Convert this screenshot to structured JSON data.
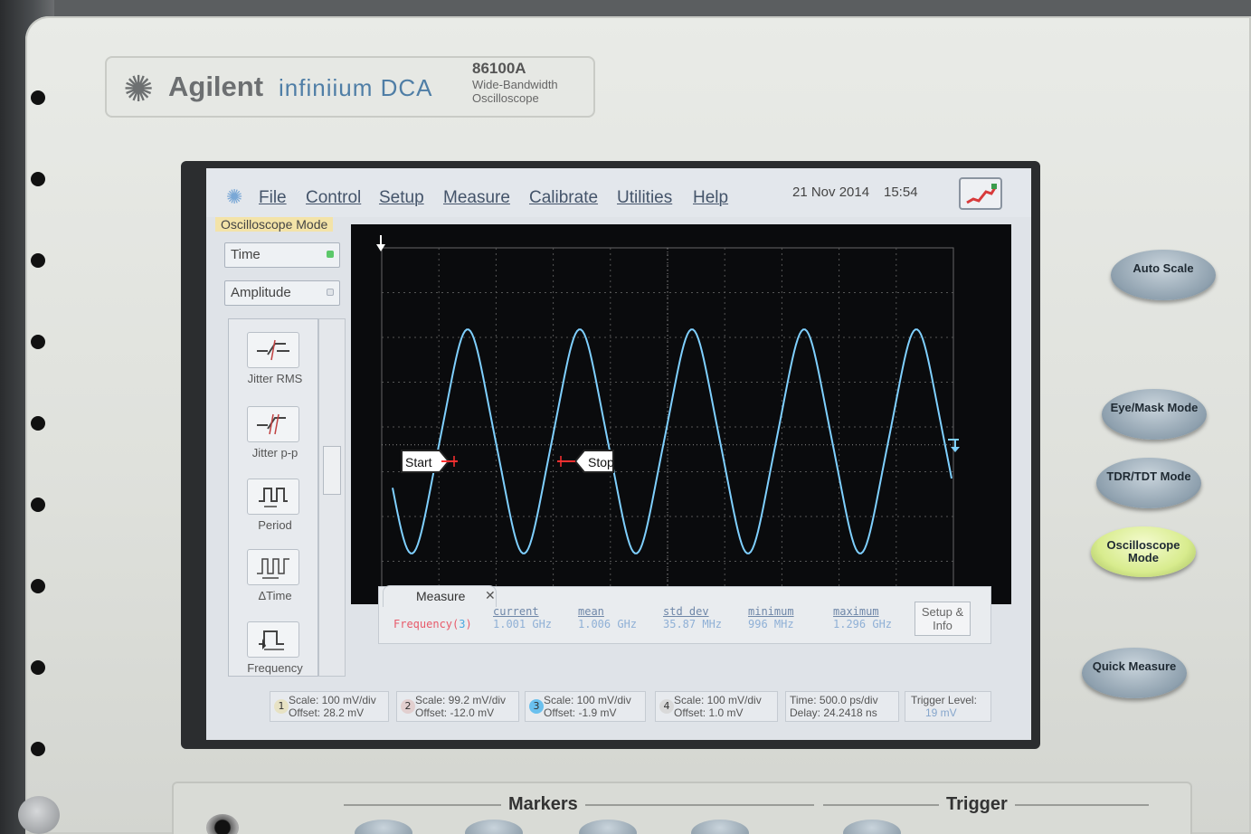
{
  "brand": {
    "name": "Agilent",
    "product": "infiniium DCA",
    "model": "86100A",
    "description": "Wide-Bandwidth Oscilloscope"
  },
  "menubar": {
    "items": [
      "File",
      "Control",
      "Setup",
      "Measure",
      "Calibrate",
      "Utilities",
      "Help"
    ],
    "date": "21 Nov 2014",
    "time": "15:54"
  },
  "mode_label": "Oscilloscope Mode",
  "side": {
    "time_button": "Time",
    "amplitude_button": "Amplitude",
    "tools": [
      "Jitter RMS",
      "Jitter p-p",
      "Period",
      "ΔTime",
      "Frequency"
    ]
  },
  "plot": {
    "start_marker": "Start",
    "stop_marker": "Stop",
    "trace_color": "#7fd0ff"
  },
  "measure": {
    "tab_label": "Measure",
    "headers": [
      "current",
      "mean",
      "std dev",
      "minimum",
      "maximum"
    ],
    "name": "Frequency(",
    "channel": "3",
    "name_close": ")",
    "values": [
      "1.001 GHz",
      "1.006 GHz",
      "35.87 MHz",
      "996 MHz",
      "1.296 GHz"
    ],
    "setup_label": "Setup & Info"
  },
  "channels": [
    {
      "num": "1",
      "scale": "Scale: 100 mV/div",
      "offset": "Offset: 28.2 mV"
    },
    {
      "num": "2",
      "scale": "Scale: 99.2 mV/div",
      "offset": "Offset: -12.0 mV"
    },
    {
      "num": "3",
      "scale": "Scale: 100 mV/div",
      "offset": "Offset: -1.9 mV"
    },
    {
      "num": "4",
      "scale": "Scale: 100 mV/div",
      "offset": "Offset: 1.0 mV"
    }
  ],
  "timebase": {
    "time": "Time: 500.0 ps/div",
    "delay": "Delay: 24.2418 ns"
  },
  "trigger": {
    "label": "Trigger Level:",
    "value": "19 mV"
  },
  "hardware_buttons": [
    "Auto Scale",
    "Eye/Mask Mode",
    "TDR/TDT Mode",
    "Oscilloscope Mode",
    "Quick Measure"
  ],
  "sections": {
    "markers": "Markers",
    "trigger": "Trigger"
  }
}
